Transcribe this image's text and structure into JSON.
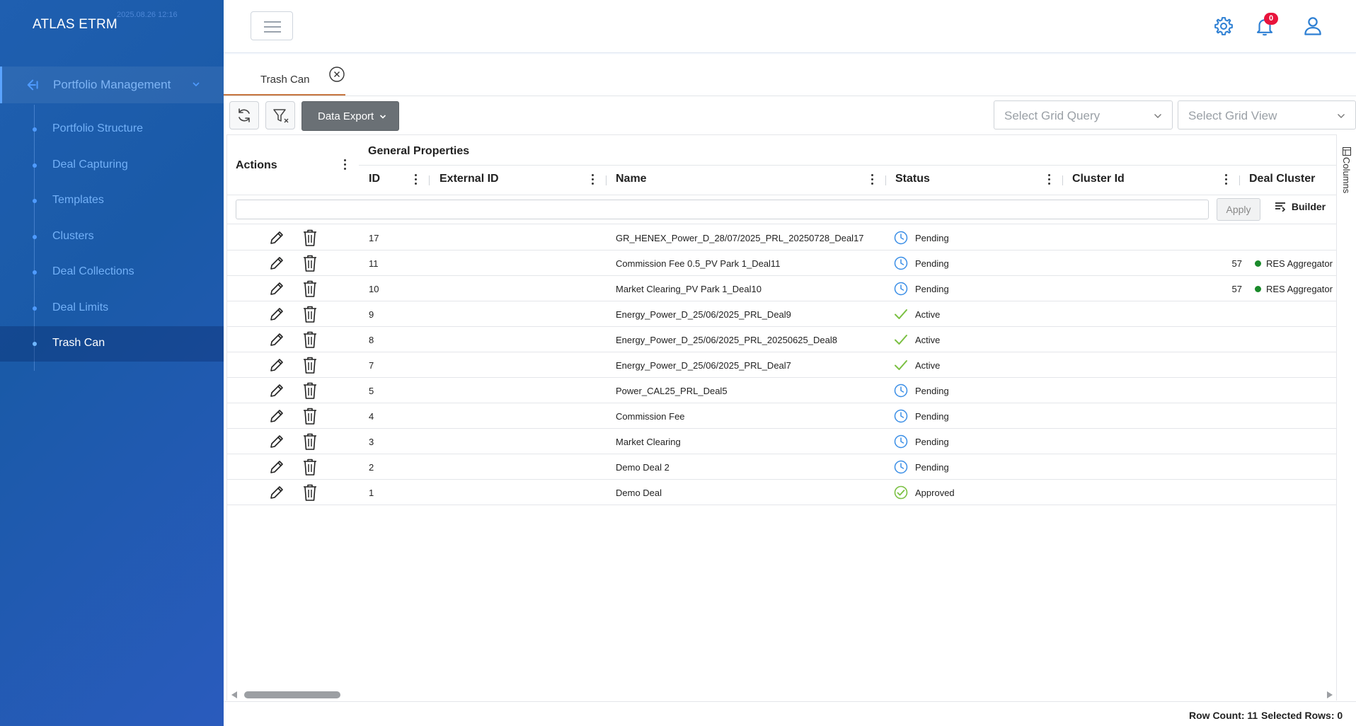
{
  "app": {
    "title": "ATLAS ETRM",
    "timestamp": "2025.08.26 12:16"
  },
  "colors": {
    "sidebar_bg": "#1f5fb0",
    "accent": "#2d7fd3",
    "tab_underline": "#c5743d",
    "badge": "#e8143c",
    "status_green": "#7bc043"
  },
  "sidebar": {
    "parent_label": "Portfolio Management",
    "items": [
      {
        "label": "Portfolio Structure",
        "active": false
      },
      {
        "label": "Deal Capturing",
        "active": false
      },
      {
        "label": "Templates",
        "active": false
      },
      {
        "label": "Clusters",
        "active": false
      },
      {
        "label": "Deal Collections",
        "active": false
      },
      {
        "label": "Deal Limits",
        "active": false
      },
      {
        "label": "Trash Can",
        "active": true
      }
    ]
  },
  "header": {
    "notifications_count": "0",
    "icons": [
      "menu-icon",
      "gear-icon",
      "bell-icon",
      "user-icon"
    ]
  },
  "tabs": [
    {
      "label": "Trash Can"
    }
  ],
  "toolbar": {
    "export_label": "Data Export",
    "grid_query_placeholder": "Select Grid Query",
    "grid_view_placeholder": "Select Grid View"
  },
  "grid": {
    "actions_header": "Actions",
    "group_header": "General Properties",
    "columns": [
      "ID",
      "External ID",
      "Name",
      "Status",
      "Cluster Id",
      "Deal Cluster"
    ],
    "apply_label": "Apply",
    "builder_label": "Builder",
    "side_panel_label": "Columns",
    "rows": [
      {
        "id": "17",
        "name": "GR_HENEX_Power_D_28/07/2025_PRL_20250728_Deal17",
        "status": "Pending",
        "status_icon": "clock-icon",
        "cluster_id": "",
        "deal_cluster": ""
      },
      {
        "id": "11",
        "name": "Commission Fee 0.5_PV Park 1_Deal11",
        "status": "Pending",
        "status_icon": "clock-icon",
        "cluster_id": "57",
        "deal_cluster": "RES Aggregator"
      },
      {
        "id": "10",
        "name": "Market Clearing_PV Park 1_Deal10",
        "status": "Pending",
        "status_icon": "clock-icon",
        "cluster_id": "57",
        "deal_cluster": "RES Aggregator"
      },
      {
        "id": "9",
        "name": "Energy_Power_D_25/06/2025_PRL_Deal9",
        "status": "Active",
        "status_icon": "check-icon",
        "cluster_id": "",
        "deal_cluster": ""
      },
      {
        "id": "8",
        "name": "Energy_Power_D_25/06/2025_PRL_20250625_Deal8",
        "status": "Active",
        "status_icon": "check-icon",
        "cluster_id": "",
        "deal_cluster": ""
      },
      {
        "id": "7",
        "name": "Energy_Power_D_25/06/2025_PRL_Deal7",
        "status": "Active",
        "status_icon": "check-icon",
        "cluster_id": "",
        "deal_cluster": ""
      },
      {
        "id": "5",
        "name": "Power_CAL25_PRL_Deal5",
        "status": "Pending",
        "status_icon": "clock-icon",
        "cluster_id": "",
        "deal_cluster": ""
      },
      {
        "id": "4",
        "name": "Commission Fee",
        "status": "Pending",
        "status_icon": "clock-icon",
        "cluster_id": "",
        "deal_cluster": ""
      },
      {
        "id": "3",
        "name": "Market Clearing",
        "status": "Pending",
        "status_icon": "clock-icon",
        "cluster_id": "",
        "deal_cluster": ""
      },
      {
        "id": "2",
        "name": "Demo Deal 2",
        "status": "Pending",
        "status_icon": "clock-icon",
        "cluster_id": "",
        "deal_cluster": ""
      },
      {
        "id": "1",
        "name": "Demo Deal",
        "status": "Approved",
        "status_icon": "check-circle-icon",
        "cluster_id": "",
        "deal_cluster": ""
      }
    ]
  },
  "footer": {
    "row_count_label": "Row Count: 11",
    "selected_rows_label": "Selected Rows: 0"
  }
}
